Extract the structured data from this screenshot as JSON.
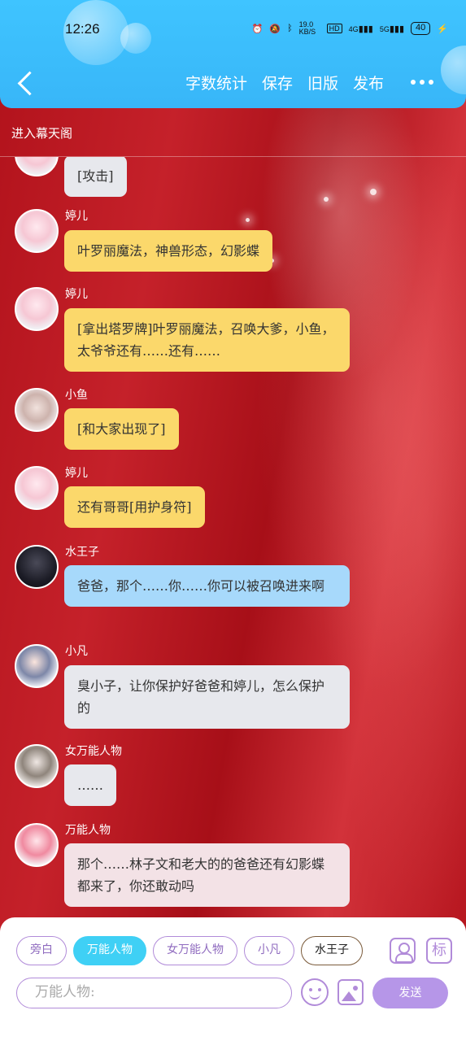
{
  "status_bar": {
    "time": "12:26",
    "net_speed": "19.0 KB/S",
    "hd": "HD",
    "signal1": "4G",
    "signal2": "5G",
    "battery": "40"
  },
  "header": {
    "actions": [
      "字数统计",
      "保存",
      "旧版",
      "发布"
    ]
  },
  "enter_bar": {
    "label": "进入幕天阁"
  },
  "messages": [
    {
      "name": "",
      "text": "[攻击]",
      "color": "gray"
    },
    {
      "name": "婷儿",
      "text": "叶罗丽魔法，神兽形态，幻影蝶",
      "color": "yellow"
    },
    {
      "name": "婷儿",
      "text": "[拿出塔罗牌]叶罗丽魔法，召唤大爹，小鱼，太爷爷还有……还有……",
      "color": "yellow"
    },
    {
      "name": "小鱼",
      "text": "[和大家出现了]",
      "color": "yellow"
    },
    {
      "name": "婷儿",
      "text": "还有哥哥[用护身符]",
      "color": "yellow"
    },
    {
      "name": "水王子",
      "text": "爸爸，那个……你……你可以被召唤进来啊",
      "color": "blue"
    },
    {
      "name": "小凡",
      "text": "臭小子，让你保护好爸爸和婷儿，怎么保护的",
      "color": "gray"
    },
    {
      "name": "女万能人物",
      "text": "……",
      "color": "gray"
    },
    {
      "name": "万能人物",
      "text": "那个……林子文和老大的的爸爸还有幻影蝶都来了，你还敢动吗",
      "color": "pink"
    }
  ],
  "composer": {
    "roles": [
      "旁白",
      "万能人物",
      "女万能人物",
      "小凡",
      "水王子"
    ],
    "active_role": "万能人物",
    "tag_label": "标",
    "input_placeholder": "万能人物:",
    "send_label": "发送"
  }
}
